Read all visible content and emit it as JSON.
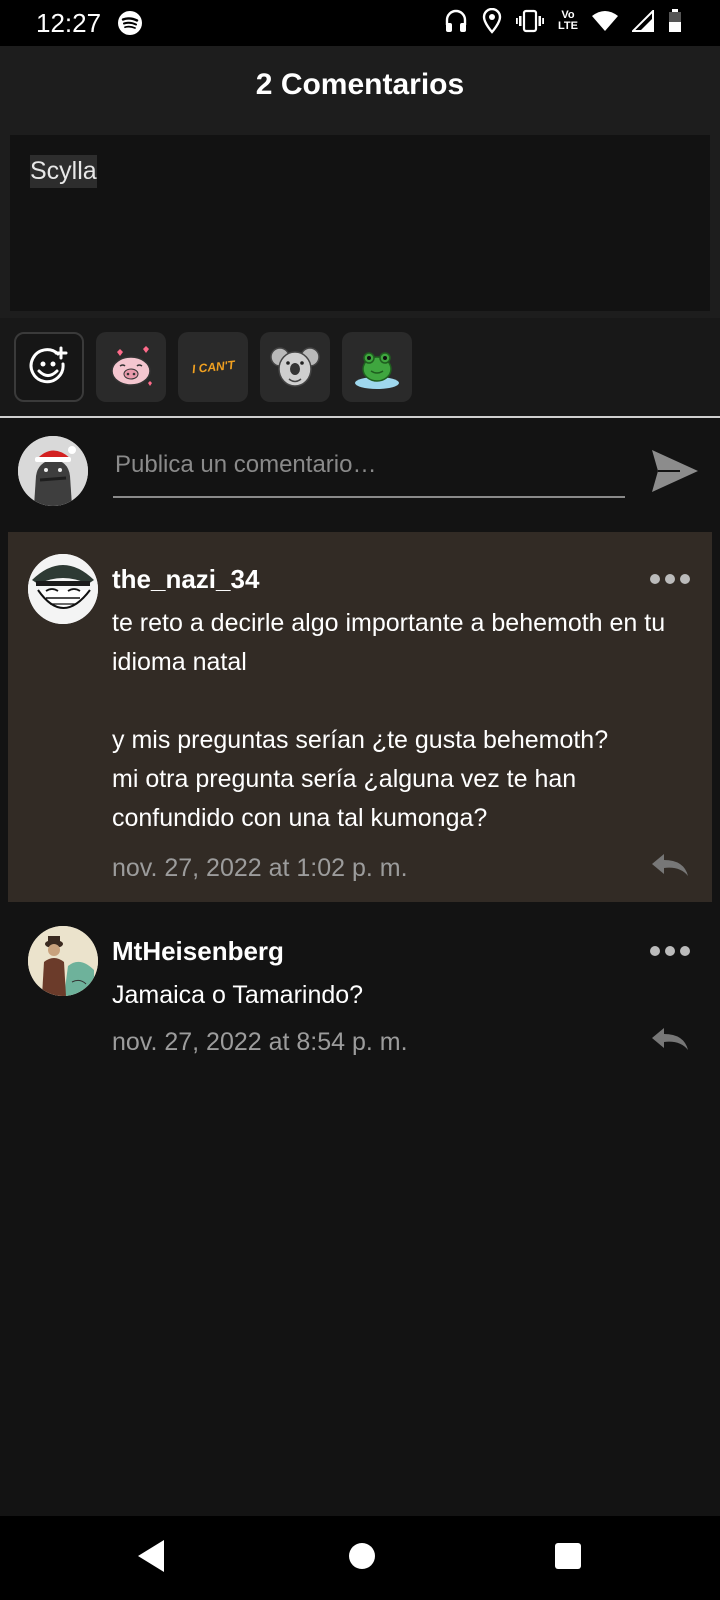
{
  "status_bar": {
    "time": "12:27",
    "network_label_top": "Vo",
    "network_label_bottom": "LTE",
    "icons": [
      "spotify-icon",
      "headphones-icon",
      "location-icon",
      "vibrate-icon",
      "volte-icon",
      "wifi-icon",
      "signal-icon",
      "battery-icon"
    ]
  },
  "header": {
    "title": "2 Comentarios"
  },
  "caption": {
    "text": "Scylla"
  },
  "sticker_bar": {
    "items": [
      "emoji-add-icon",
      "pig-sticker",
      "i-cant-sticker",
      "koala-sticker",
      "frog-sticker"
    ],
    "i_cant_text": "I CAN'T"
  },
  "comment_input": {
    "placeholder": "Publica un comentario…",
    "value": ""
  },
  "comments": [
    {
      "user": "the_nazi_34",
      "text": "te reto a decirle algo importante a behemoth en tu idioma natal\n\ny mis preguntas serían ¿te gusta behemoth?\nmi otra pregunta sería ¿alguna vez te han confundido con una tal kumonga?",
      "date": "nov. 27, 2022 at 1:02 p. m."
    },
    {
      "user": "MtHeisenberg",
      "text": "Jamaica o Tamarindo?",
      "date": "nov. 27, 2022 at 8:54 p. m."
    }
  ],
  "colors": {
    "background": "#131313",
    "highlight_comment": "#322b25",
    "muted_text": "#9c9c9c"
  }
}
